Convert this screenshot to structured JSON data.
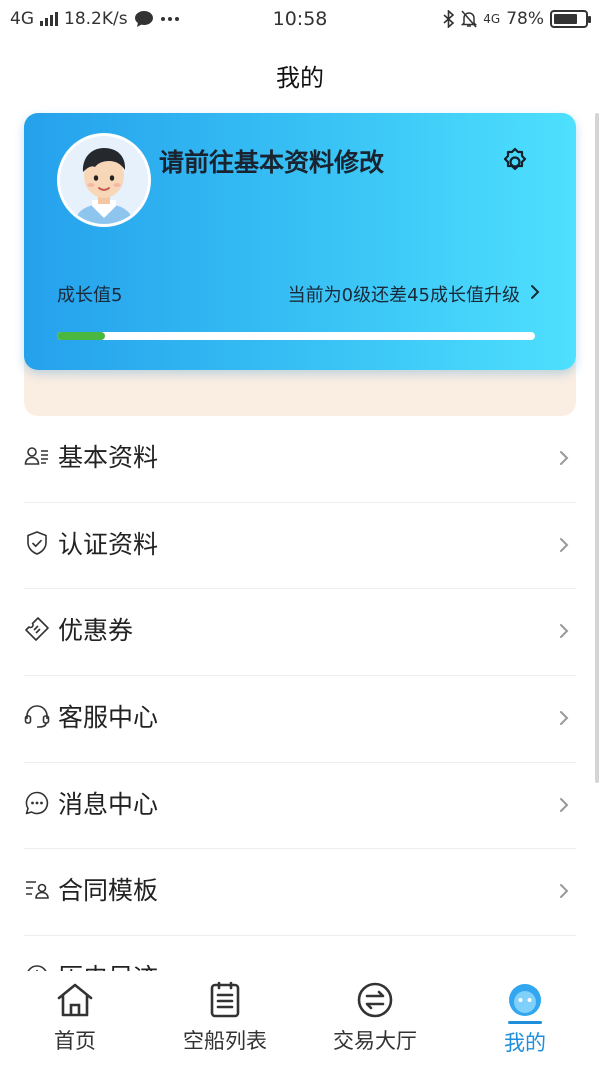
{
  "status_bar": {
    "network": "4G",
    "speed": "18.2K/s",
    "time": "10:58",
    "network_right": "4G",
    "battery": "78%",
    "battery_level": 0.78
  },
  "page": {
    "title": "我的"
  },
  "profile": {
    "name_prompt": "请前往基本资料修改",
    "growth_value": "成长值5",
    "level_status": "当前为0级还差45成长值升级",
    "progress": 0.1
  },
  "menu": {
    "items": [
      {
        "label": "基本资料",
        "icon": "user-card-icon"
      },
      {
        "label": "认证资料",
        "icon": "shield-check-icon"
      },
      {
        "label": "优惠券",
        "icon": "ticket-icon"
      },
      {
        "label": "客服中心",
        "icon": "headset-icon"
      },
      {
        "label": "消息中心",
        "icon": "chat-bubble-icon"
      },
      {
        "label": "合同模板",
        "icon": "contract-icon"
      },
      {
        "label": "历史足迹",
        "icon": "history-icon"
      }
    ]
  },
  "tabbar": {
    "tabs": [
      {
        "label": "首页",
        "icon": "home-icon"
      },
      {
        "label": "空船列表",
        "icon": "clipboard-icon"
      },
      {
        "label": "交易大厅",
        "icon": "exchange-icon"
      },
      {
        "label": "我的",
        "icon": "profile-face-icon"
      }
    ],
    "active_color": "#1f8fdc"
  }
}
